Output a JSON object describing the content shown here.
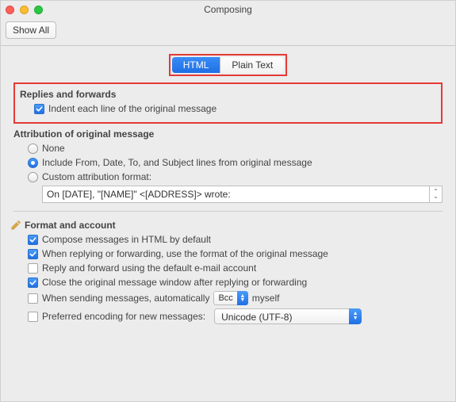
{
  "window": {
    "title": "Composing",
    "showAll": "Show All"
  },
  "tabs": {
    "html": "HTML",
    "plain": "Plain Text"
  },
  "replies": {
    "heading": "Replies and forwards",
    "indent": "Indent each line of the original message"
  },
  "attribution": {
    "heading": "Attribution of original message",
    "none": "None",
    "include": "Include From, Date, To, and Subject lines from original message",
    "custom": "Custom attribution format:",
    "customValue": "On [DATE], \"[NAME]\" <[ADDRESS]> wrote:"
  },
  "format": {
    "heading": "Format and account",
    "composeHtml": "Compose messages in HTML by default",
    "matchFormat": "When replying or forwarding, use the format of the original message",
    "defaultAccount": "Reply and forward using the default e-mail account",
    "closeWindow": "Close the original message window after replying or forwarding",
    "autoBccPre": "When sending messages, automatically",
    "autoBccPopup": "Bcc",
    "autoBccPost": "myself",
    "encodingLabel": "Preferred encoding for new messages:",
    "encodingValue": "Unicode (UTF-8)"
  }
}
